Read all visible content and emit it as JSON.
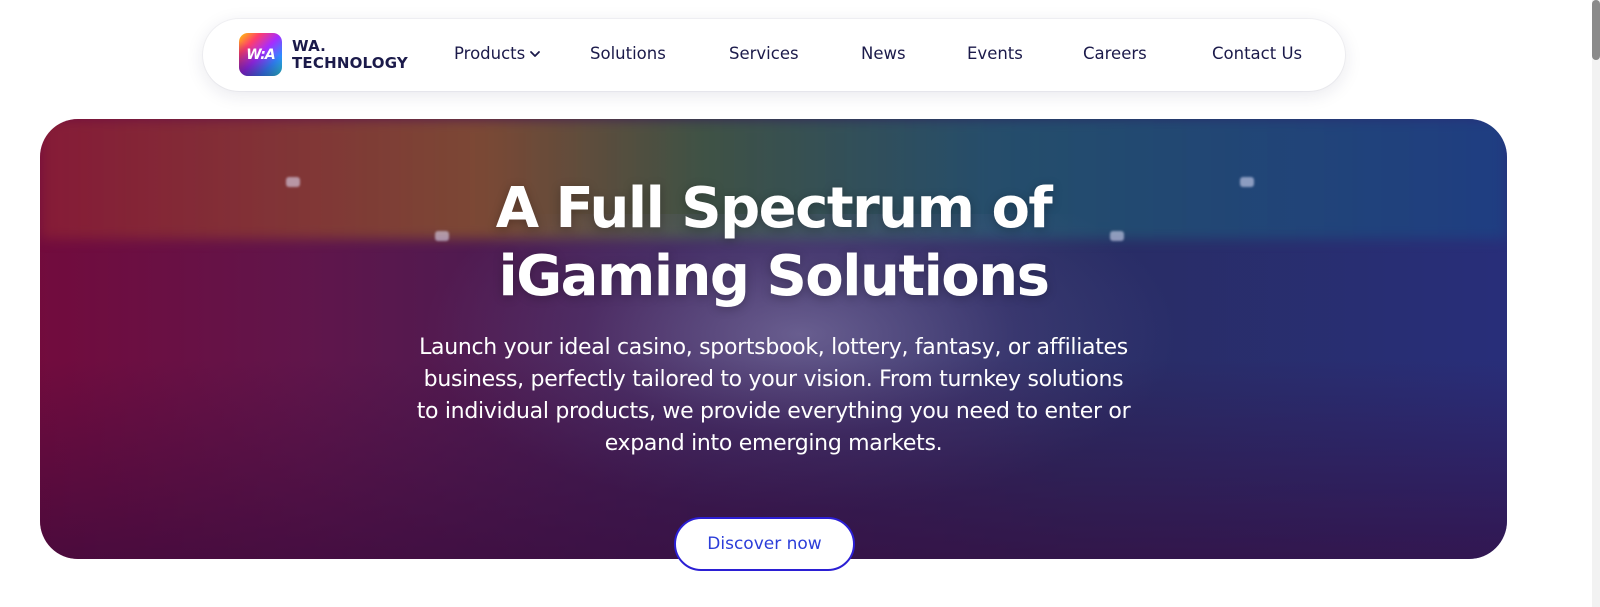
{
  "logo": {
    "glyph": "W:A",
    "line1": "WA.",
    "line2": "TECHNOLOGY"
  },
  "nav": {
    "items": [
      {
        "label": "Products",
        "has_dropdown": true
      },
      {
        "label": "Solutions"
      },
      {
        "label": "Services"
      },
      {
        "label": "News"
      },
      {
        "label": "Events"
      },
      {
        "label": "Careers"
      },
      {
        "label": "Contact Us"
      }
    ]
  },
  "hero": {
    "title_line1": "A Full Spectrum of",
    "title_line2": "iGaming Solutions",
    "subtitle": "Launch your ideal casino, sportsbook, lottery, fantasy, or affiliates business, perfectly tailored to your vision. From turnkey solutions to individual products, we provide everything you need to enter or expand into emerging markets.",
    "cta_label": "Discover now"
  },
  "colors": {
    "nav_text": "#1b1a4a",
    "cta_border": "#2b1fd4",
    "cta_text": "#2b3dd9"
  },
  "icons": {
    "dropdown": "chevron-down-icon"
  }
}
